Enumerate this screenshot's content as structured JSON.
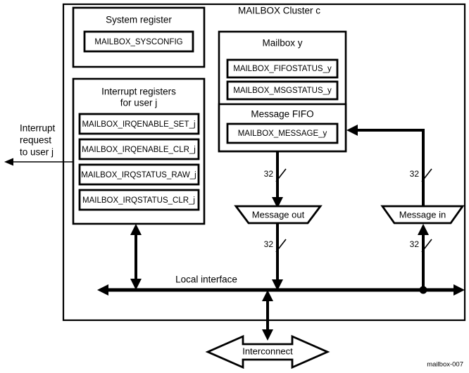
{
  "figure": {
    "caption": "mailbox-007",
    "cluster_title": "MAILBOX Cluster c"
  },
  "system_register_group": {
    "title": "System register",
    "registers": [
      {
        "name": "MAILBOX_SYSCONFIG"
      }
    ]
  },
  "interrupt_register_group": {
    "title_line1": "Interrupt registers",
    "title_line2": "for user j",
    "registers": [
      {
        "name": "MAILBOX_IRQENABLE_SET_j"
      },
      {
        "name": "MAILBOX_IRQENABLE_CLR_j"
      },
      {
        "name": "MAILBOX_IRQSTATUS_RAW_j"
      },
      {
        "name": "MAILBOX_IRQSTATUS_CLR_j"
      }
    ]
  },
  "mailbox_group": {
    "title": "Mailbox y",
    "registers": [
      {
        "name": "MAILBOX_FIFOSTATUS_y"
      },
      {
        "name": "MAILBOX_MSGSTATUS_y"
      }
    ],
    "fifo": {
      "title": "Message FIFO",
      "registers": [
        {
          "name": "MAILBOX_MESSAGE_y"
        }
      ]
    }
  },
  "ports": {
    "message_out": "Message out",
    "message_in": "Message in"
  },
  "interrupt_output": {
    "line1": "Interrupt",
    "line2": "request",
    "line3": "to user j"
  },
  "bus": {
    "local_interface": "Local interface",
    "interconnect": "Interconnect"
  },
  "bus_widths": {
    "out_upper": "32",
    "out_lower": "32",
    "in_upper": "32",
    "in_lower": "32"
  }
}
